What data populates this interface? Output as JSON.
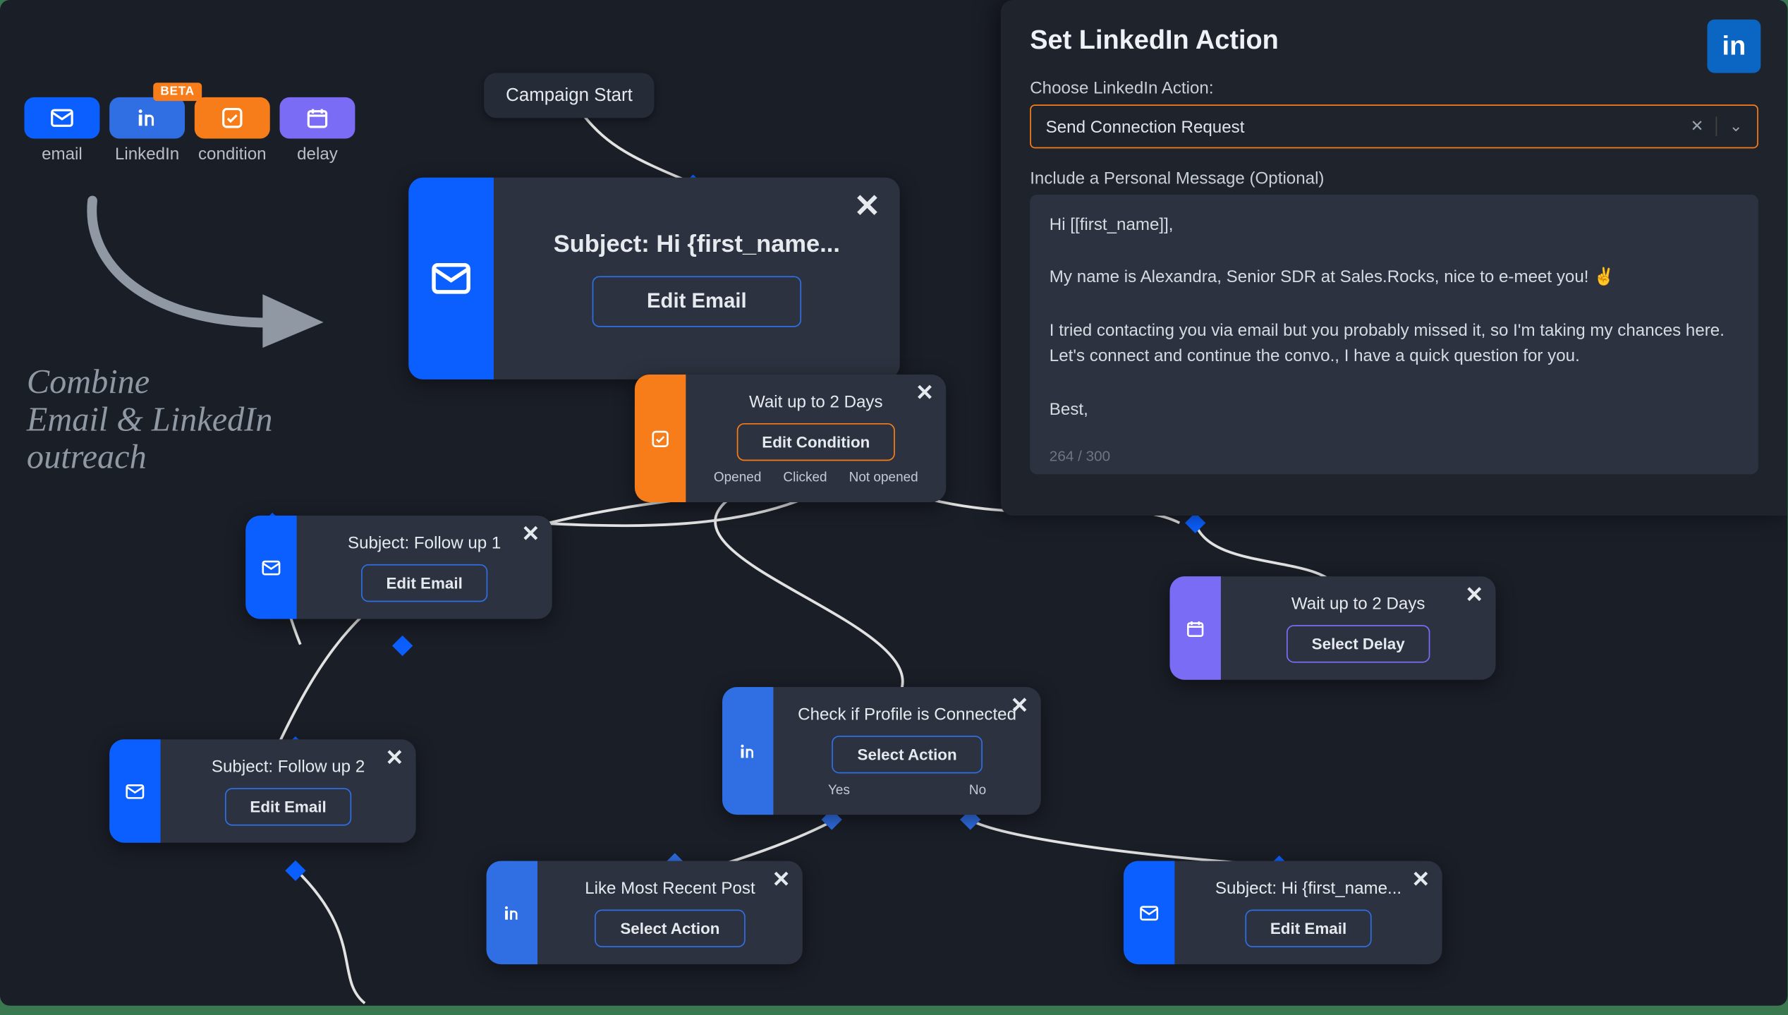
{
  "palette": {
    "email": "email",
    "linkedin": "LinkedIn",
    "condition": "condition",
    "delay": "delay",
    "beta": "BETA"
  },
  "caption": "Combine\nEmail & LinkedIn\noutreach",
  "start": "Campaign Start",
  "nodes": {
    "email1": {
      "title": "Subject: Hi {first_name...",
      "btn": "Edit Email"
    },
    "cond": {
      "title": "Wait up to 2 Days",
      "btn": "Edit Condition",
      "o1": "Opened",
      "o2": "Clicked",
      "o3": "Not opened"
    },
    "fu1": {
      "title": "Subject: Follow up 1",
      "btn": "Edit Email"
    },
    "fu2": {
      "title": "Subject: Follow up 2",
      "btn": "Edit Email"
    },
    "lin1": {
      "title": "Check if Profile is Connected",
      "btn": "Select Action",
      "yes": "Yes",
      "no": "No"
    },
    "lin2": {
      "title": "Like Most Recent Post",
      "btn": "Select Action"
    },
    "delay": {
      "title": "Wait up to 2 Days",
      "btn": "Select Delay"
    },
    "email2": {
      "title": "Subject: Hi {first_name...",
      "btn": "Edit Email"
    }
  },
  "panel": {
    "heading": "Set LinkedIn Action",
    "chooseLabel": "Choose LinkedIn Action:",
    "selected": "Send Connection Request",
    "msgLabel": "Include a Personal Message (Optional)",
    "msg": "Hi [[first_name]],\n\nMy name is Alexandra, Senior SDR at Sales.Rocks, nice to e-meet you! ✌️\n\nI tried contacting you via email but you probably missed it, so I'm taking my chances here. Let's connect and continue the convo., I have a quick question for you.\n\nBest,",
    "counter": "264 / 300"
  }
}
